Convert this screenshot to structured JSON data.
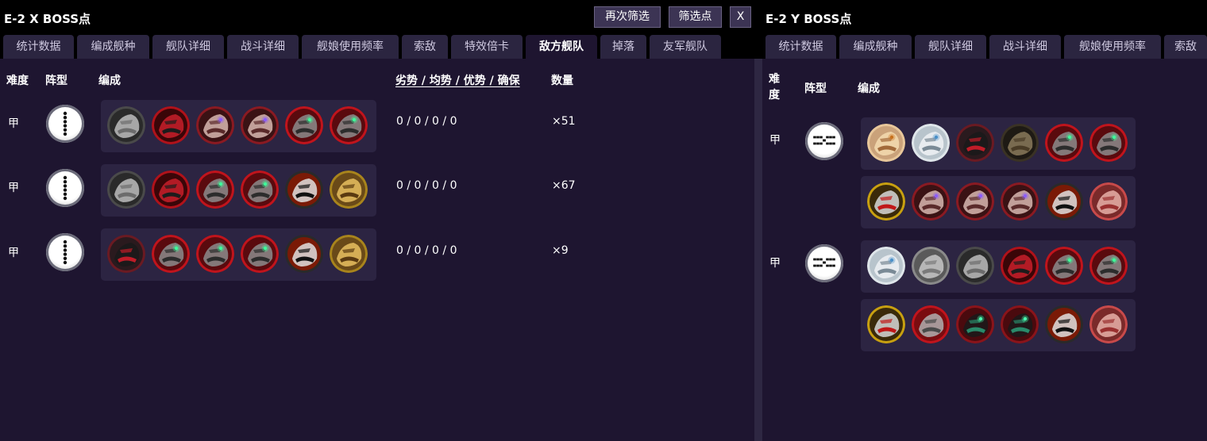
{
  "left": {
    "title": "E-2 X BOSS点",
    "buttons": {
      "refilter": "再次筛选",
      "filter_point": "筛选点",
      "close": "X"
    },
    "tabs": [
      "统计数据",
      "编成舰种",
      "舰队详细",
      "战斗详细",
      "舰娘使用频率",
      "索敌",
      "特效倍卡",
      "敌方舰队",
      "掉落",
      "友军舰队"
    ],
    "active_tab": 7,
    "headers": {
      "difficulty": "难度",
      "formation": "阵型",
      "composition": "编成",
      "ratio": "劣势 / 均势 / 优势 / 确保",
      "count": "数量"
    },
    "rows": [
      {
        "difficulty": "甲",
        "formation": "line-ahead-icon",
        "ratio": "0 / 0 / 0 / 0",
        "count": "×51",
        "ships": [
          "abyssal-gray-fist-icon",
          "abyssal-red-helmet-icon",
          "abyssal-maw-purple-eye-icon",
          "abyssal-maw-purple-eye-icon",
          "abyssal-red-green-eye-icon",
          "abyssal-red-green-eye-icon"
        ]
      },
      {
        "difficulty": "甲",
        "formation": "line-ahead-icon",
        "ratio": "0 / 0 / 0 / 0",
        "count": "×67",
        "ships": [
          "abyssal-gray-fist-icon",
          "abyssal-red-helmet-icon",
          "abyssal-red-green-eye-icon",
          "abyssal-red-green-eye-icon",
          "abyssal-black-fire-icon",
          "abyssal-gold-claw-icon"
        ]
      },
      {
        "difficulty": "甲",
        "formation": "line-ahead-icon",
        "ratio": "0 / 0 / 0 / 0",
        "count": "×9",
        "ships": [
          "abyssal-dark-girl-icon",
          "abyssal-red-green-eye-icon",
          "abyssal-red-green-eye-icon",
          "abyssal-red-green-eye-icon",
          "abyssal-black-fire-icon",
          "abyssal-gold-claw-icon"
        ]
      }
    ]
  },
  "right": {
    "title": "E-2 Y BOSS点",
    "tabs": [
      "统计数据",
      "编成舰种",
      "舰队详细",
      "战斗详细",
      "舰娘使用频率",
      "索敌"
    ],
    "headers": {
      "difficulty": "难\n度",
      "formation": "阵型",
      "composition": "编成"
    },
    "rows": [
      {
        "difficulty": "甲",
        "formation": "combined-formation-icon",
        "main_fleet": [
          "blonde-girl-icon",
          "white-hair-girl-icon",
          "abyssal-dark-girl-icon",
          "abyssal-brown-turret-icon",
          "abyssal-red-green-eye-icon",
          "abyssal-red-green-eye-icon"
        ],
        "escort_fleet": [
          "abyssal-yellow-black-icon",
          "abyssal-maw-purple-eye-icon",
          "abyssal-maw-purple-eye-icon",
          "abyssal-maw-purple-eye-icon",
          "abyssal-black-fire-icon",
          "abyssal-red-shard-icon"
        ]
      },
      {
        "difficulty": "甲",
        "formation": "combined-formation-icon",
        "main_fleet": [
          "white-hair-girl-icon",
          "abyssal-gray-hood-icon",
          "abyssal-gray-fist-icon",
          "abyssal-red-helmet-icon",
          "abyssal-red-green-eye-icon",
          "abyssal-red-green-eye-icon"
        ],
        "escort_fleet": [
          "abyssal-yellow-black-icon",
          "abyssal-red-gray-icon",
          "abyssal-dark-teal-icon",
          "abyssal-dark-teal-icon",
          "abyssal-black-fire-icon",
          "abyssal-red-shard-icon"
        ]
      }
    ]
  },
  "colors": {
    "background": "#000000",
    "content": "#1e1530",
    "tab": "#2b2540",
    "card": "#2c2442",
    "button": "#3c3454"
  }
}
